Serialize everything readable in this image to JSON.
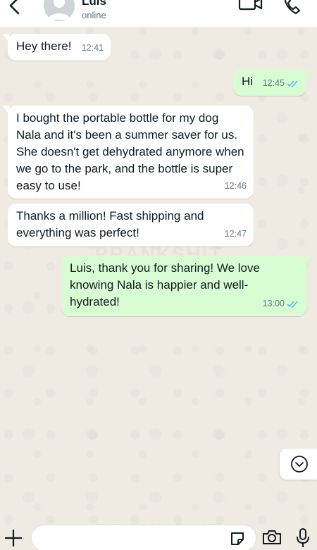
{
  "header": {
    "contact_name": "Luis",
    "status": "online",
    "icons": [
      "back-arrow-icon",
      "avatar-placeholder",
      "video-call-icon",
      "phone-call-icon"
    ]
  },
  "messages": [
    {
      "direction": "incoming",
      "text": "Hey there!",
      "time": "12:41"
    },
    {
      "direction": "outgoing",
      "text": "Hi",
      "time": "12:45",
      "read": true
    },
    {
      "direction": "incoming",
      "text": "I bought the portable bottle for my dog Nala and it's been a summer saver for us. She doesn't get dehydrated anymore when we go to the park, and the bottle is super easy to use!",
      "time": "12:46"
    },
    {
      "direction": "incoming",
      "text": "Thanks a million! Fast shipping and everything was perfect!",
      "time": "12:47"
    },
    {
      "direction": "outgoing",
      "text": "Luis, thank you for sharing! We love knowing Nala is happier and well-hydrated!",
      "time": "13:00",
      "read": true
    }
  ],
  "watermark": "PRANKSHIT",
  "input": {
    "placeholder": "",
    "value": ""
  },
  "colors": {
    "chat_background": "#efeae2",
    "incoming_bubble": "#ffffff",
    "outgoing_bubble": "#d9fdd3",
    "read_ticks": "#53bdeb",
    "meta_text": "#667781"
  }
}
